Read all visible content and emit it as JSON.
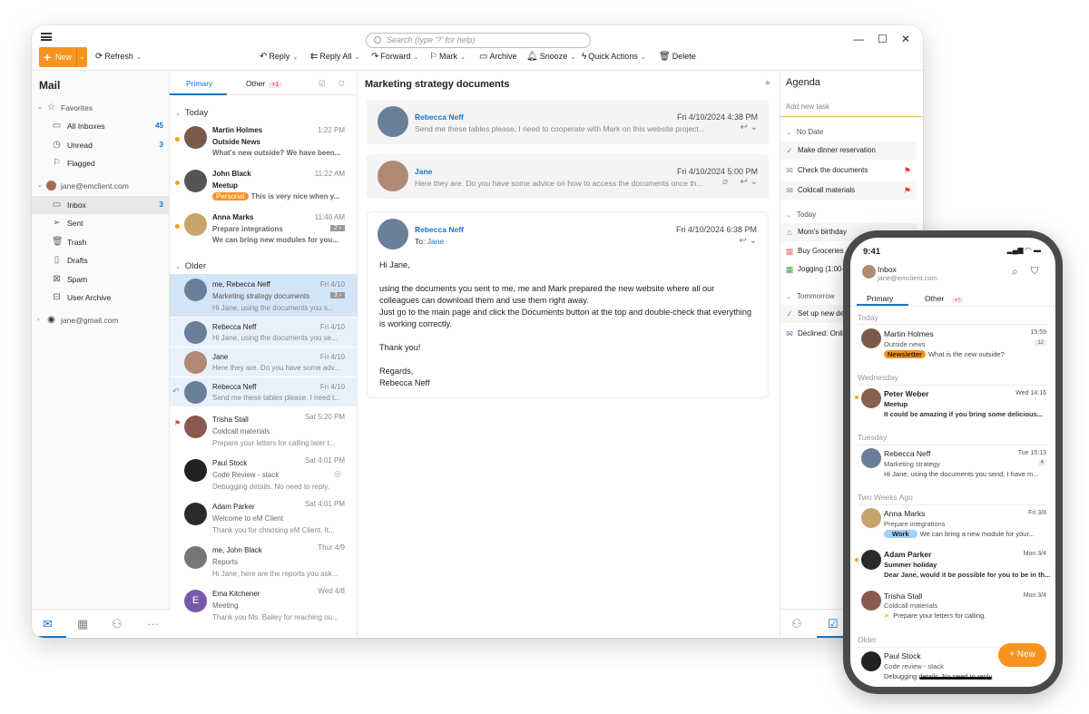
{
  "app": {
    "search_placeholder": "Search (type '?' for help)",
    "window_controls": {
      "minimize": "—",
      "maximize": "☐",
      "close": "✕"
    }
  },
  "toolbar": {
    "new_label": "New",
    "refresh_label": "Refresh",
    "reply_label": "Reply",
    "reply_all_label": "Reply All",
    "forward_label": "Forward",
    "mark_label": "Mark",
    "archive_label": "Archive",
    "snooze_label": "Snooze",
    "quick_actions_label": "Quick Actions",
    "delete_label": "Delete"
  },
  "sidebar": {
    "title": "Mail",
    "favorites_label": "Favorites",
    "favorites": [
      {
        "label": "All Inboxes",
        "count": "45",
        "icon": "inbox-icon"
      },
      {
        "label": "Unread",
        "count": "3",
        "icon": "clock-icon"
      },
      {
        "label": "Flagged",
        "count": "",
        "icon": "flag-icon"
      }
    ],
    "account1": "jane@emclient.com",
    "folders": [
      {
        "label": "Inbox",
        "count": "3",
        "icon": "inbox-icon"
      },
      {
        "label": "Sent",
        "count": "",
        "icon": "send-icon"
      },
      {
        "label": "Trash",
        "count": "",
        "icon": "trash-icon"
      },
      {
        "label": "Drafts",
        "count": "",
        "icon": "draft-icon"
      },
      {
        "label": "Spam",
        "count": "",
        "icon": "spam-icon"
      },
      {
        "label": "User Archive",
        "count": "",
        "icon": "archive-icon"
      }
    ],
    "account2": "jane@gmail.com"
  },
  "list": {
    "tab_primary": "Primary",
    "tab_other": "Other",
    "other_badge": "+1",
    "group_today": "Today",
    "group_older": "Older",
    "today": [
      {
        "from": "Martin Holmes",
        "time": "1:22 PM",
        "subject": "Outside News",
        "preview": "What's new outside? We have been...",
        "unread": true
      },
      {
        "from": "John Black",
        "time": "11:22 AM",
        "subject": "Meetup",
        "tag": "Personal",
        "preview": "This is very nice when y...",
        "unread": true
      },
      {
        "from": "Anna Marks",
        "time": "11:40 AM",
        "subject": "Prepare integrations",
        "count": "2 ›",
        "preview": "We can bring new modules for you...",
        "unread": true
      }
    ],
    "older": [
      {
        "from": "me, Rebecca Neff",
        "time": "Fri 4/10",
        "subject": "Marketing strategy documents",
        "count": "3 ›",
        "preview": "Hi Jane, using the documents you s..."
      },
      {
        "from": "Rebecca Neff",
        "time": "Fri 4/10",
        "preview": "Hi Jane, using the documents you se..."
      },
      {
        "from": "Jane",
        "time": "Fri 4/10",
        "preview": "Here they are. Do you have some adv..."
      },
      {
        "from": "Rebecca Neff",
        "time": "Fri 4/10",
        "preview": "Send me these tables please, I need t..."
      },
      {
        "from": "Trisha Stall",
        "time": "Sat 5:20 PM",
        "subject": "Coldcall materials",
        "preview": "Prepare your letters for calling later t..."
      },
      {
        "from": "Paul Stock",
        "time": "Sat 4:01 PM",
        "subject": "Code Review - stack",
        "preview": "Debugging details. No need to reply."
      },
      {
        "from": "Adam Parker",
        "time": "Sat 4:01 PM",
        "subject": "Welcome to eM Client",
        "preview": "Thank you for choosing eM Client. It..."
      },
      {
        "from": "me, John Black",
        "time": "Thur 4/9",
        "subject": "Reports",
        "preview": "Hi Jane, here are the reports you ask..."
      },
      {
        "from": "Ema Kitchener",
        "time": "Wed 4/8",
        "subject": "Meeting",
        "preview": "Thank you Ms. Bailey for reaching ou...",
        "initial": "E"
      }
    ]
  },
  "reading": {
    "title": "Marketing strategy documents",
    "collapsed": [
      {
        "from": "Rebecca Neff",
        "date": "Fri 4/10/2024 4:38 PM",
        "preview": "Send me these tables please, I need to cooperate with Mark on this website project..."
      },
      {
        "from": "Jane",
        "date": "Fri 4/10/2024 5:00 PM",
        "preview": "Here they are. Do you have some advice on how to access the documents once th..."
      }
    ],
    "expanded": {
      "from": "Rebecca Neff",
      "to_label": "To:",
      "to": "Jane",
      "date": "Fri 4/10/2024 6:38 PM",
      "greeting": "Hi Jane,",
      "para1": "using the documents you sent to me, me and Mark prepared the new website where all our colleagues can download them and use them right away.",
      "para2": "Just go to the main page and click the Documents button at the top and double-check that everything is working correctly.",
      "thanks": "Thank you!",
      "regards": "Regards,",
      "signature": "Rebecca Neff"
    }
  },
  "agenda": {
    "title": "Agenda",
    "add_placeholder": "Add new task",
    "no_date_label": "No Date",
    "no_date": [
      {
        "label": "Make dinner reservation",
        "icon": "check-icon",
        "flag": false
      },
      {
        "label": "Check the documents",
        "icon": "mail-icon",
        "flag": true
      },
      {
        "label": "Coldcall materials",
        "icon": "mail-icon",
        "flag": true
      }
    ],
    "today_label": "Today",
    "today": [
      {
        "label": "Mom's birthday",
        "icon": "cake-icon"
      },
      {
        "label": "Buy Groceries",
        "icon": "calendar-icon"
      },
      {
        "label": "Jogging (1:00-",
        "icon": "calendar-icon"
      }
    ],
    "tomorrow_label": "Tommorrow",
    "tomorrow": [
      {
        "label": "Set up new des",
        "icon": "check-icon"
      },
      {
        "label": "Declined: Onlin",
        "icon": "mail-icon"
      }
    ]
  },
  "phone": {
    "time": "9:41",
    "inbox_label": "Inbox",
    "account": "jane@emclient.com",
    "tab_primary": "Primary",
    "tab_other": "Other",
    "other_badge": "+7",
    "groups": {
      "today": "Today",
      "wednesday": "Wednesday",
      "tuesday": "Tuesday",
      "two_weeks": "Two Weeks Ago",
      "older": "Older"
    },
    "messages": [
      {
        "from": "Martin Holmes",
        "time": "15:59",
        "subject": "Outside news",
        "tag": "Newsletter",
        "preview": "What is the new outside?",
        "count": "12"
      },
      {
        "from": "Peter Weber",
        "time": "Wed 14:16",
        "subject": "Meetup",
        "preview": "It could be amazing if you bring some delicious..."
      },
      {
        "from": "Rebecca Neff",
        "time": "Tue 15:13",
        "subject": "Marketing strategy",
        "preview": "Hi Jane, using the documents you send, I have m...",
        "count": "4"
      },
      {
        "from": "Anna Marks",
        "time": "Fri 3/8",
        "subject": "Prepare integrations",
        "tag": "Work",
        "preview": "We can bring a new module for your..."
      },
      {
        "from": "Adam Parker",
        "time": "Mon 3/4",
        "subject": "Summer holiday",
        "preview": "Dear Jane, would it be possible for you to be in th..."
      },
      {
        "from": "Trisha Stall",
        "time": "Mon 3/4",
        "subject": "Coldcall materials",
        "preview": "Prepare your letters for calling."
      },
      {
        "from": "Paul Stock",
        "time": "",
        "subject": "Code review - stack",
        "preview": "Debugging details. No need to reply."
      }
    ],
    "new_label": "New"
  },
  "colors": {
    "accent": "#f7931e",
    "link": "#1a73c8",
    "selection": "#d4e5f7",
    "flag": "#e53935"
  }
}
